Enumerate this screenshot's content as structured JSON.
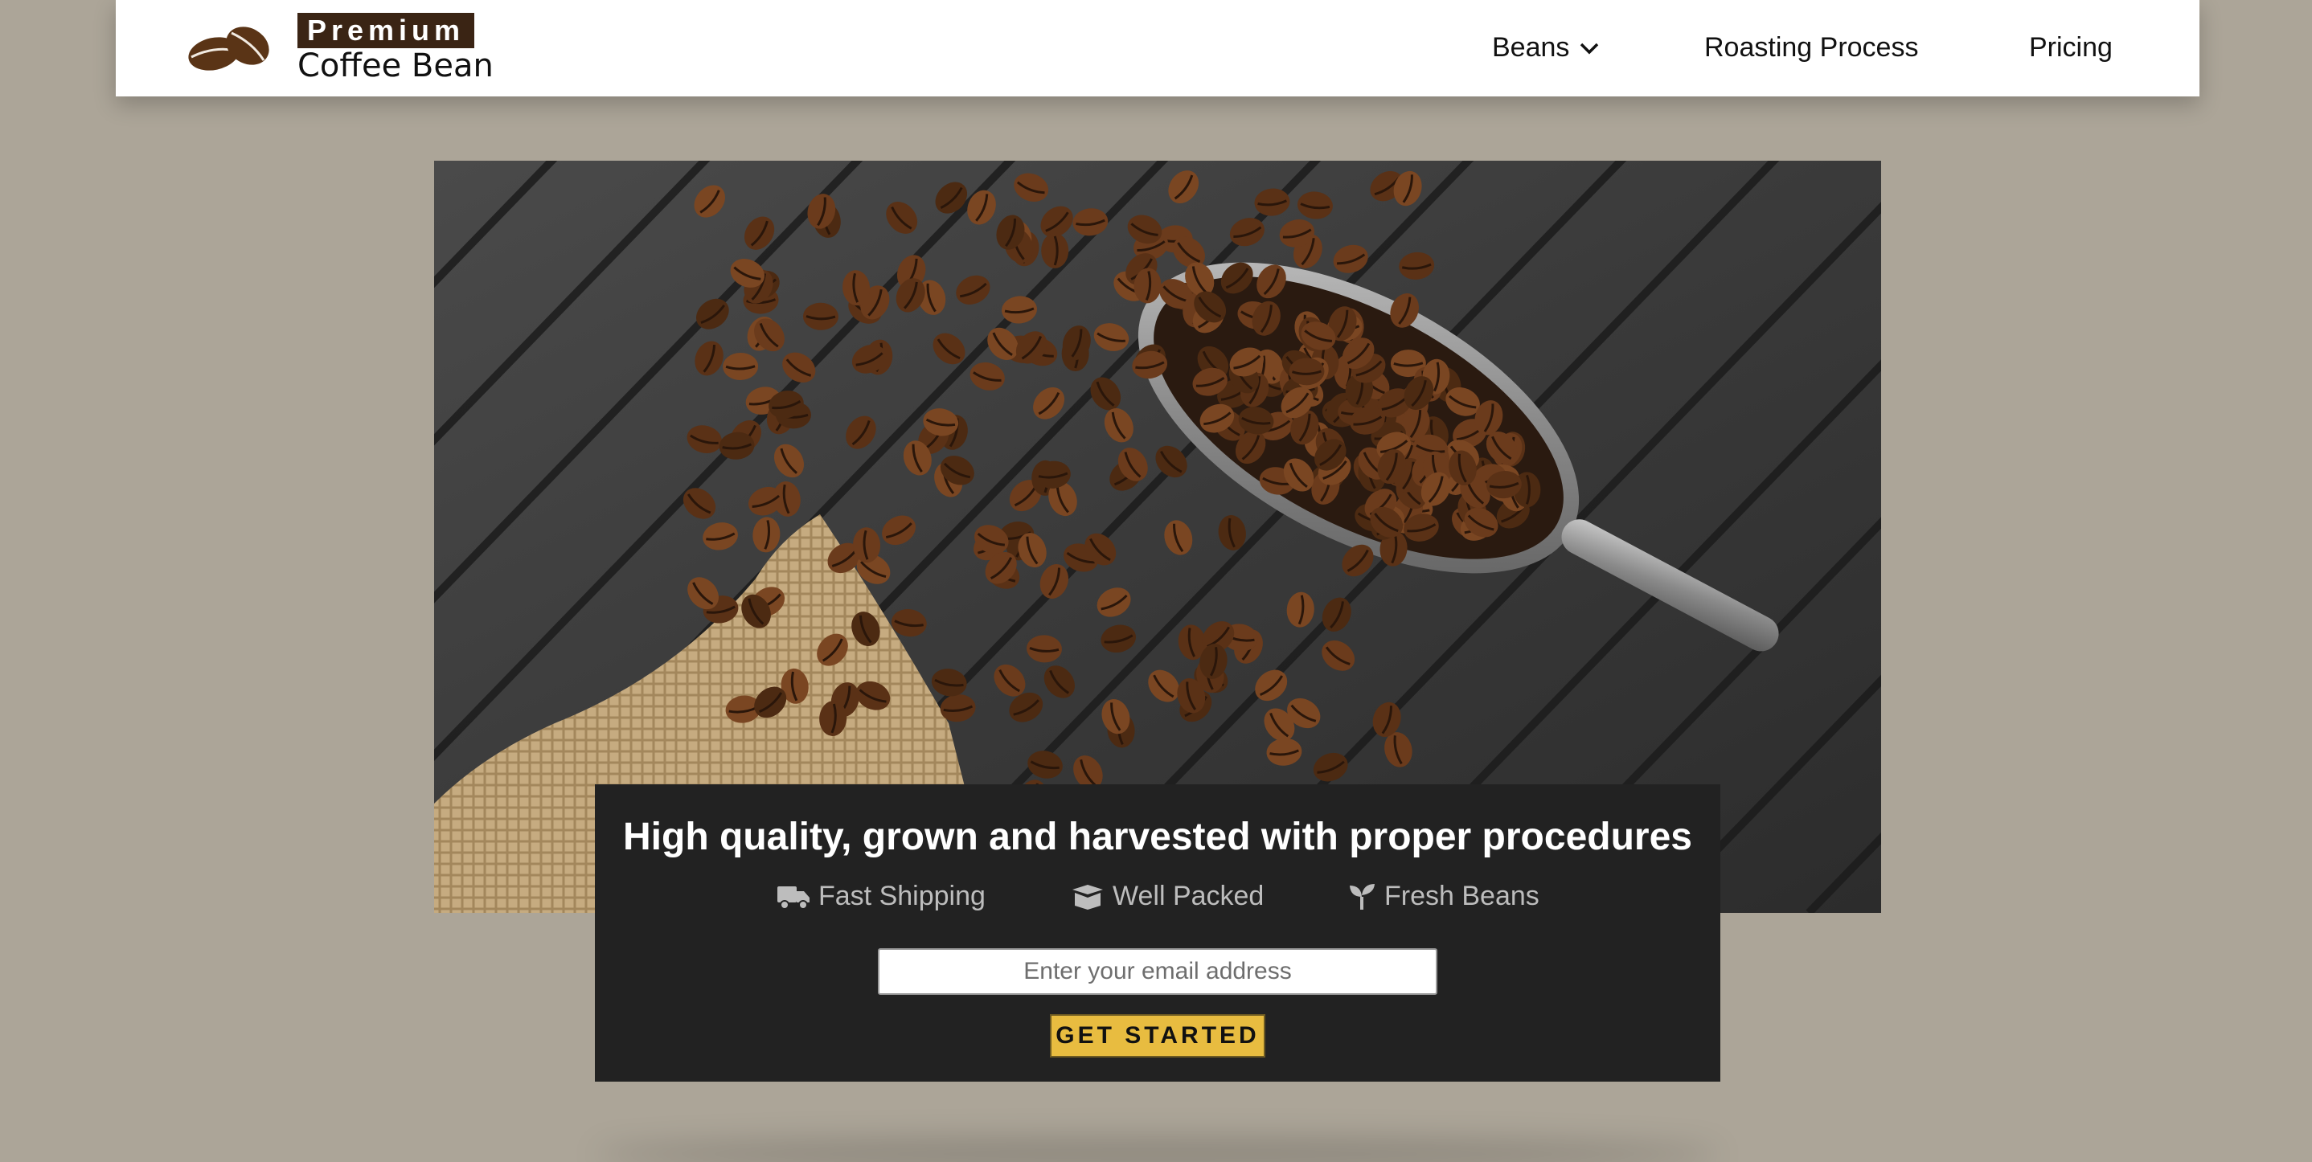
{
  "brand": {
    "top_label": "Premium",
    "bottom_label": "Coffee Bean",
    "logo_icon": "coffee-beans-icon",
    "color": "#3a2414"
  },
  "nav": {
    "items": [
      {
        "label": "Beans",
        "icon": "chevron-down-icon"
      },
      {
        "label": "Roasting Process"
      },
      {
        "label": "Pricing"
      }
    ]
  },
  "hero": {
    "image": "coffee-beans-scoop-photo"
  },
  "cta": {
    "title": "High quality, grown and harvested with proper procedures",
    "features": [
      {
        "label": "Fast Shipping",
        "icon": "truck-icon"
      },
      {
        "label": "Well Packed",
        "icon": "box-icon"
      },
      {
        "label": "Fresh Beans",
        "icon": "sprout-icon"
      }
    ],
    "email_placeholder": "Enter your email address",
    "button_label": "GET STARTED",
    "button_color": "#e8bc40"
  }
}
